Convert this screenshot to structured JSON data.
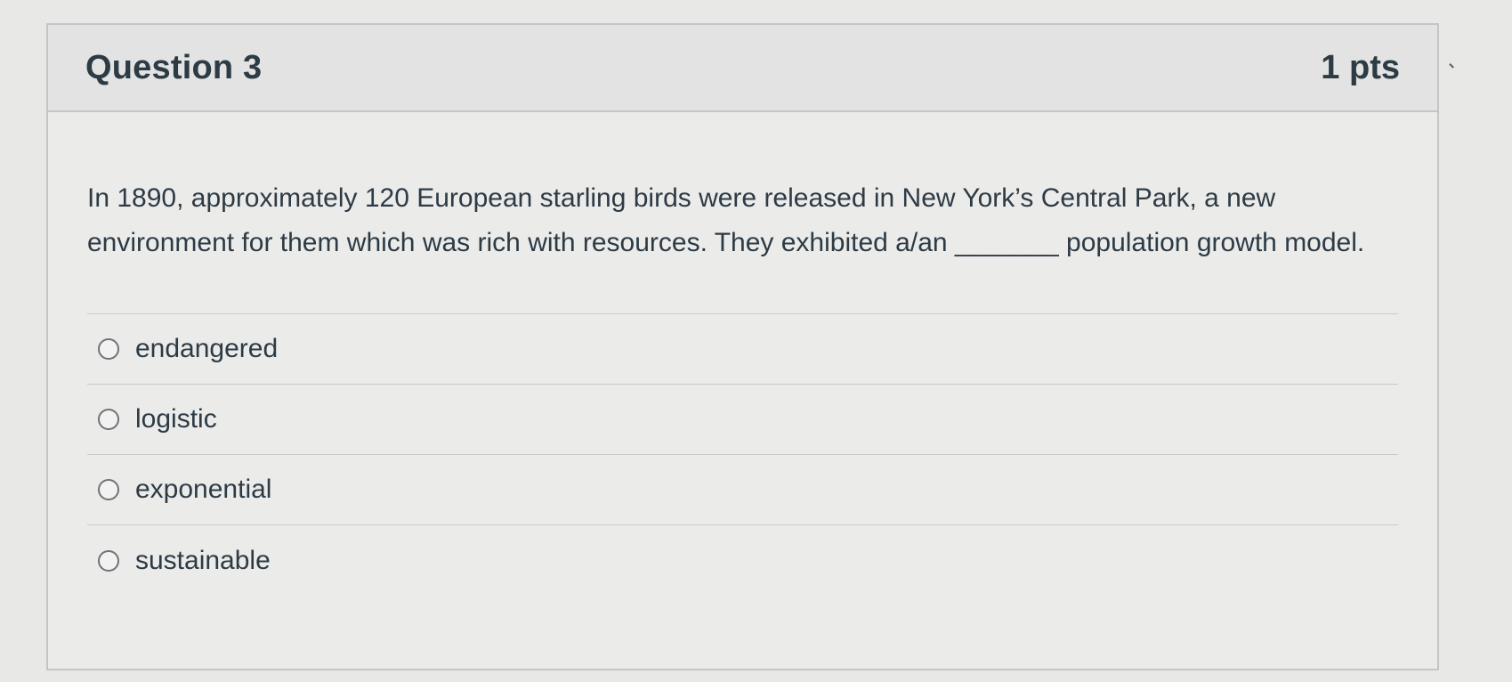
{
  "question": {
    "title": "Question 3",
    "points": "1 pts",
    "text": "In 1890, approximately 120 European starling birds were released in New York’s Central Park, a new environment for them which was rich with resources. They exhibited a/an _______ population growth model."
  },
  "answers": [
    {
      "label": "endangered",
      "selected": false
    },
    {
      "label": "logistic",
      "selected": false
    },
    {
      "label": "exponential",
      "selected": false
    },
    {
      "label": "sustainable",
      "selected": false
    }
  ],
  "colors": {
    "text": "#2d3b45",
    "border": "#c4c6c6",
    "header_bg": "#e2e3e2"
  }
}
